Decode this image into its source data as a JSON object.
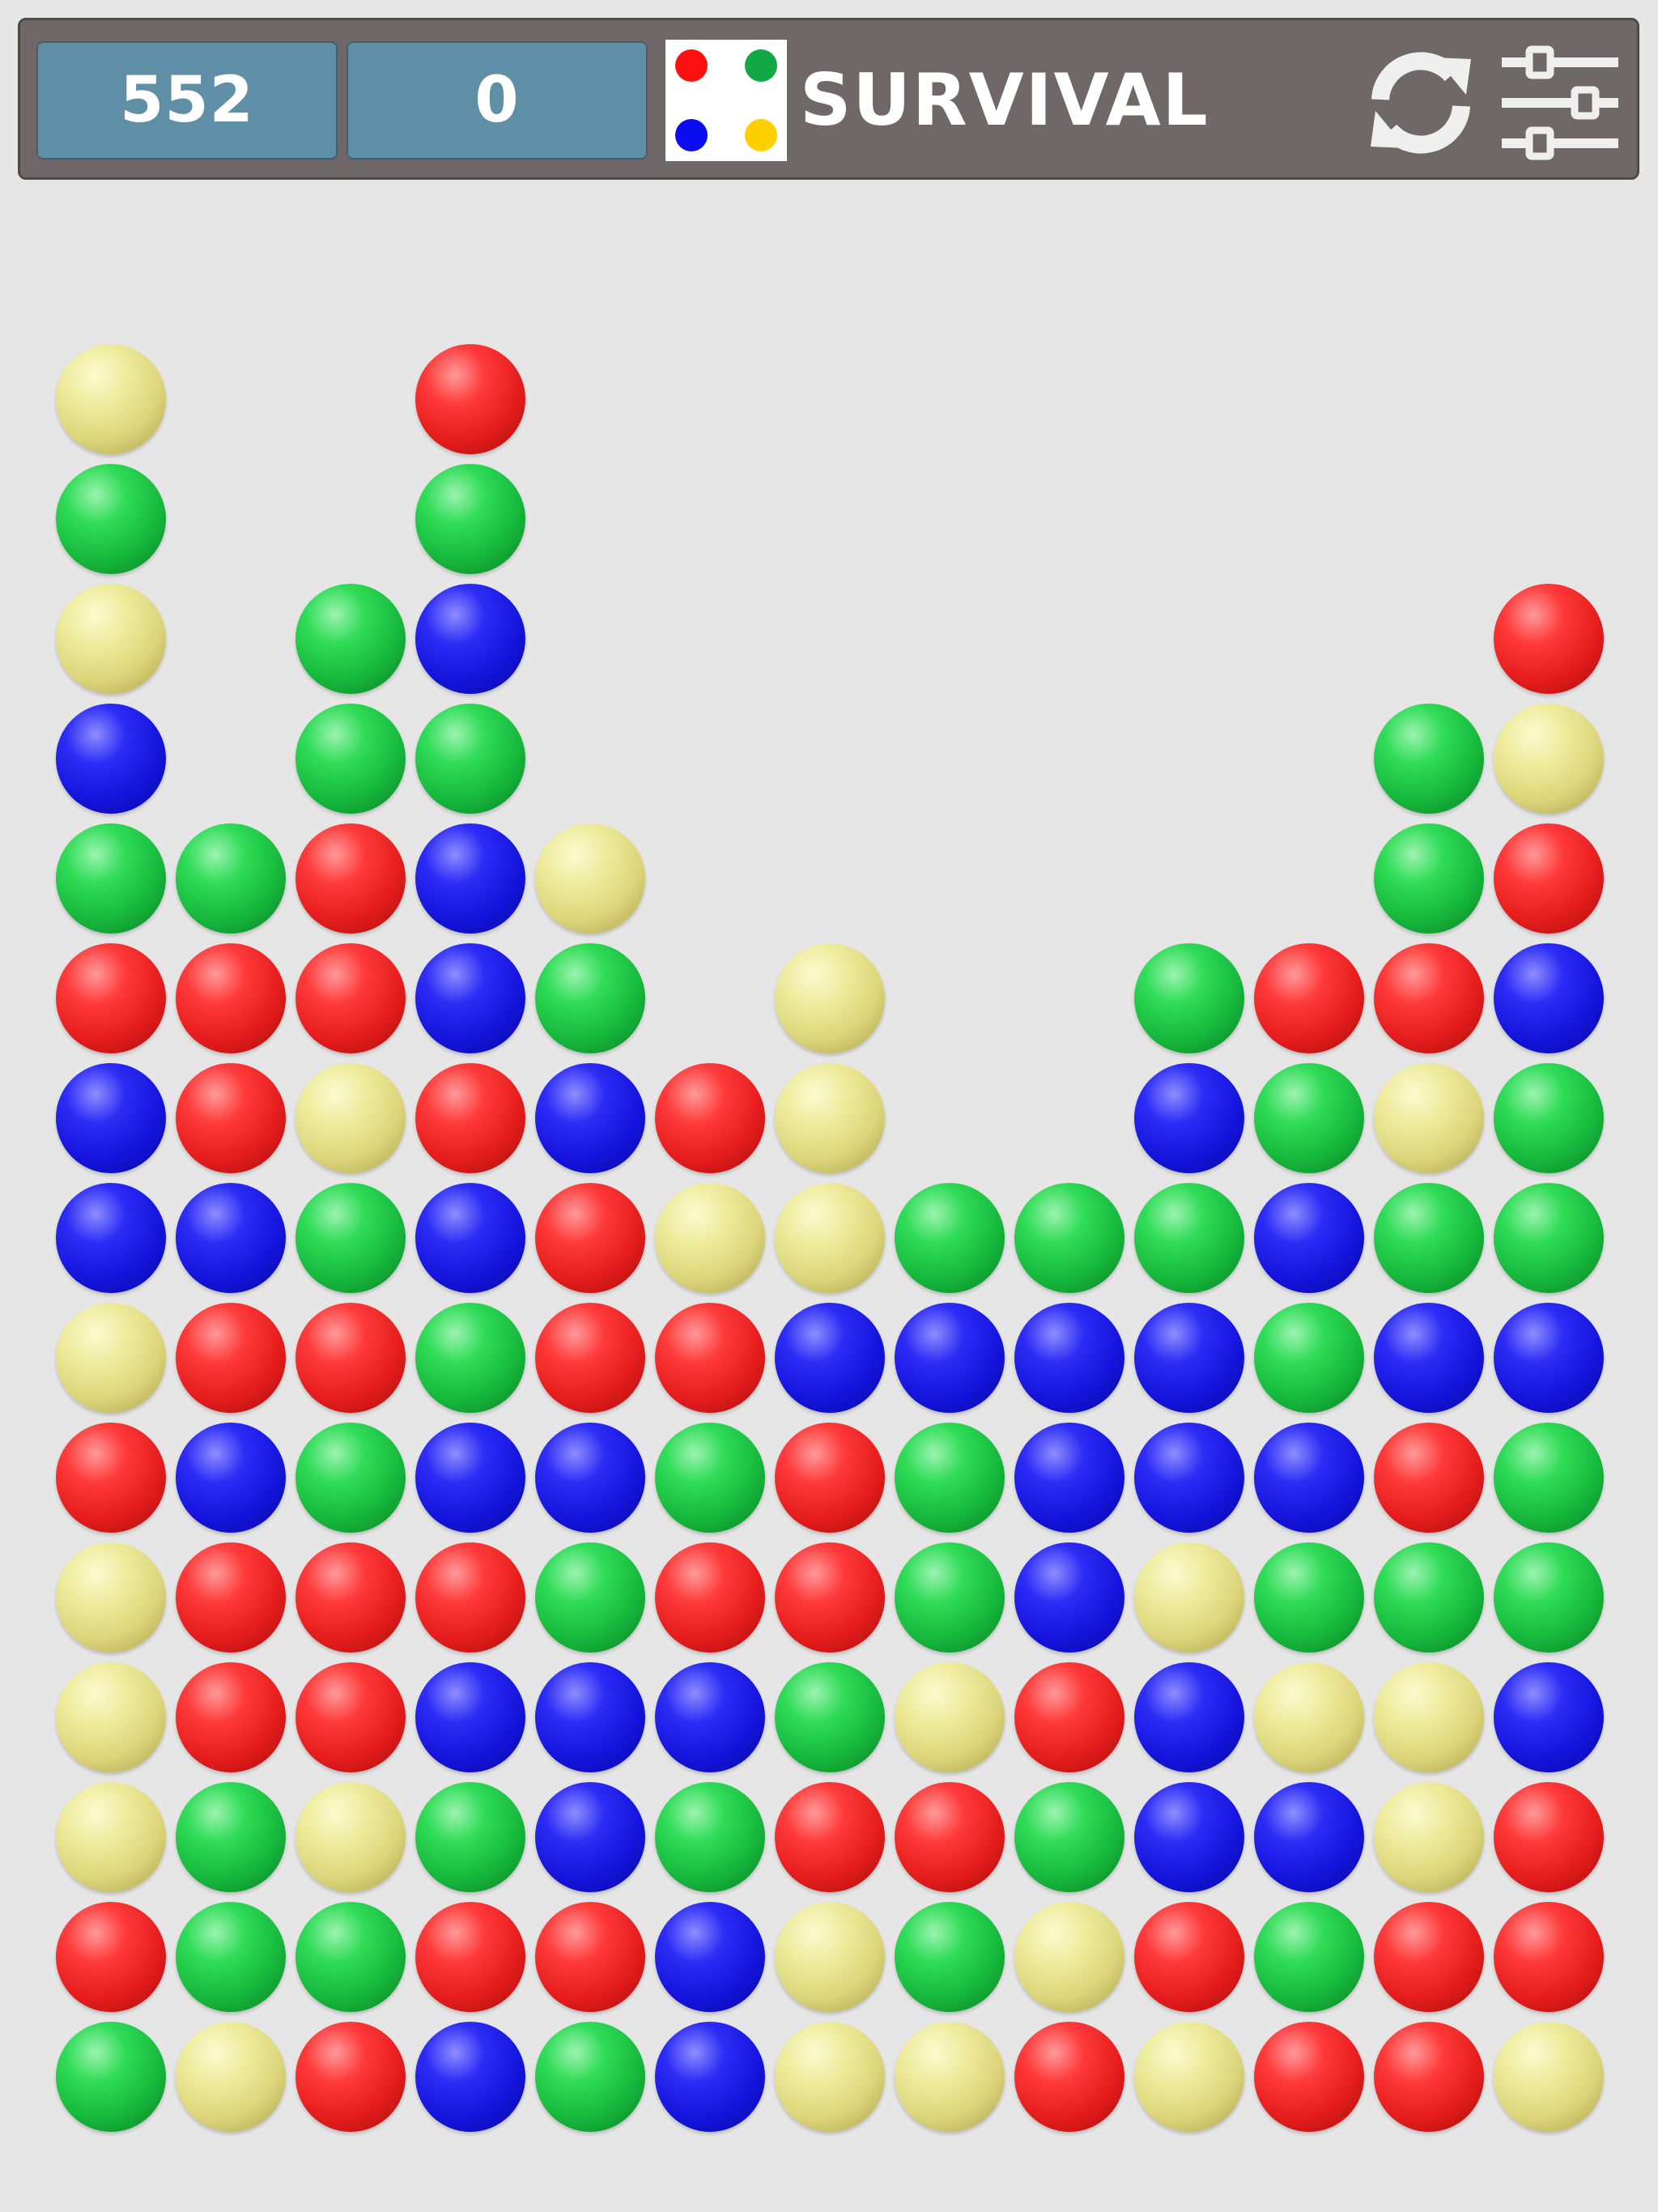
{
  "header": {
    "score": "552",
    "moves": "0",
    "mode": "SURVIVAL",
    "indicator_colors": [
      "red",
      "green",
      "blue",
      "yellow"
    ]
  },
  "controls": {
    "restart_icon": "refresh-icon",
    "settings_icon": "sliders-icon"
  },
  "colors": {
    "red": "#e51c1c",
    "green": "#16b83c",
    "blue": "#1414dc",
    "yellow": "#dcd57a",
    "background": "#e6e6e6",
    "topbar": "#706868",
    "counter": "#5f8fa6"
  },
  "board": {
    "columns": 13,
    "rows": 15,
    "grid_from_bottom": [
      [
        "G",
        "R",
        "Y",
        "Y",
        "Y",
        "R",
        "Y",
        "B",
        "B",
        "R",
        "G",
        "B",
        "Y",
        "G",
        "Y"
      ],
      [
        "Y",
        "G",
        "G",
        "R",
        "R",
        "B",
        "R",
        "B",
        "R",
        "R",
        "G"
      ],
      [
        "R",
        "G",
        "Y",
        "R",
        "R",
        "G",
        "R",
        "G",
        "Y",
        "R",
        "R",
        "G",
        "G"
      ],
      [
        "B",
        "R",
        "G",
        "B",
        "R",
        "B",
        "G",
        "B",
        "R",
        "B",
        "B",
        "G",
        "B",
        "G",
        "R"
      ],
      [
        "G",
        "R",
        "B",
        "B",
        "G",
        "B",
        "R",
        "R",
        "B",
        "G",
        "Y"
      ],
      [
        "B",
        "B",
        "G",
        "B",
        "R",
        "G",
        "R",
        "Y",
        "R"
      ],
      [
        "Y",
        "Y",
        "R",
        "G",
        "R",
        "R",
        "B",
        "Y",
        "Y",
        "Y"
      ],
      [
        "Y",
        "G",
        "R",
        "Y",
        "G",
        "G",
        "B",
        "G"
      ],
      [
        "R",
        "Y",
        "G",
        "R",
        "B",
        "B",
        "B",
        "G"
      ],
      [
        "Y",
        "R",
        "B",
        "B",
        "Y",
        "B",
        "B",
        "G",
        "B",
        "G"
      ],
      [
        "R",
        "G",
        "B",
        "Y",
        "G",
        "B",
        "G",
        "B",
        "G",
        "R"
      ],
      [
        "R",
        "R",
        "Y",
        "Y",
        "G",
        "R",
        "B",
        "G",
        "Y",
        "R",
        "G",
        "G"
      ],
      [
        "Y",
        "R",
        "R",
        "B",
        "G",
        "G",
        "B",
        "G",
        "G",
        "B",
        "R",
        "Y",
        "R"
      ]
    ]
  }
}
